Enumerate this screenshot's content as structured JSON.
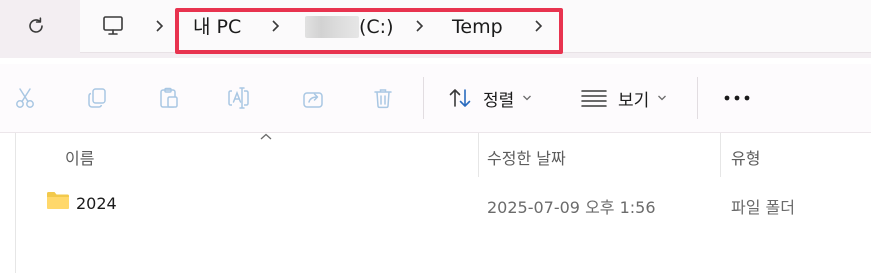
{
  "address_bar": {
    "crumbs": [
      "내 PC",
      "(C:)",
      "Temp"
    ],
    "icons": [
      "refresh-icon",
      "computer-icon",
      "chevron-right-icon"
    ]
  },
  "toolbar": {
    "buttons": [
      "cut-icon",
      "copy-icon",
      "paste-icon",
      "rename-icon",
      "share-icon",
      "delete-icon"
    ],
    "sort_label": "정렬",
    "view_label": "보기",
    "more_icon": "more-icon"
  },
  "file_list": {
    "columns": [
      "이름",
      "수정한 날짜",
      "유형"
    ],
    "rows": [
      {
        "name": "2024",
        "modified": "2025-07-09 오후 1:56",
        "type": "파일 폴더",
        "icon": "folder-icon"
      }
    ]
  },
  "colors": {
    "highlight_box": "#e8334f",
    "folder": "#f2c94c",
    "disabled_icon": "#a9c7e3"
  }
}
